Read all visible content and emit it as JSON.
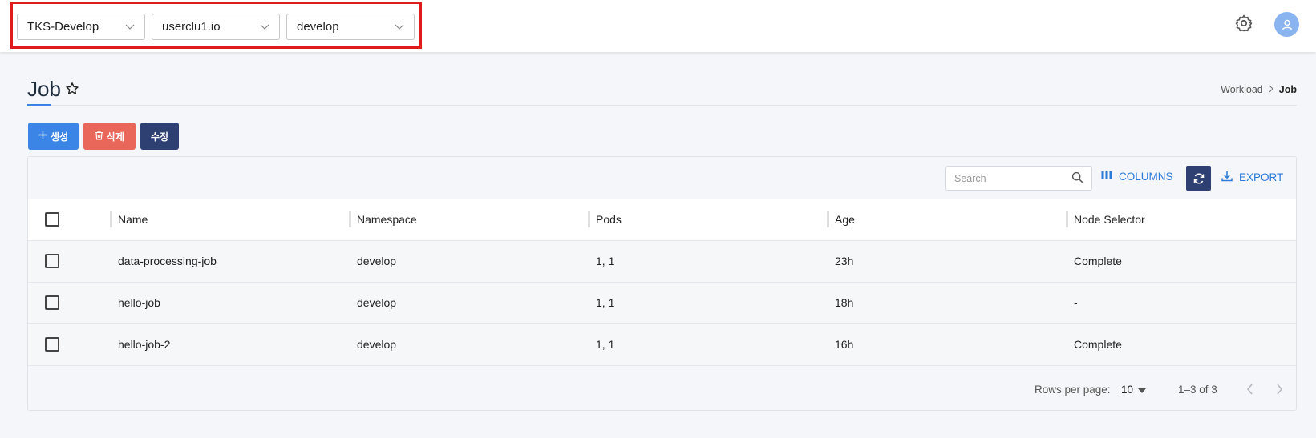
{
  "header": {
    "selectors": [
      {
        "value": "TKS-Develop"
      },
      {
        "value": "userclu1.io"
      },
      {
        "value": "develop"
      }
    ]
  },
  "page": {
    "title": "Job",
    "breadcrumb": [
      "Workload",
      "Job"
    ]
  },
  "actions": {
    "create_label": "생성",
    "delete_label": "삭제",
    "edit_label": "수정"
  },
  "toolbar": {
    "search_placeholder": "Search",
    "columns_label": "COLUMNS",
    "export_label": "EXPORT"
  },
  "table": {
    "columns": [
      "Name",
      "Namespace",
      "Pods",
      "Age",
      "Node Selector"
    ],
    "rows": [
      {
        "name": "data-processing-job",
        "namespace": "develop",
        "pods": "1, 1",
        "age": "23h",
        "node_selector": "Complete"
      },
      {
        "name": "hello-job",
        "namespace": "develop",
        "pods": "1, 1",
        "age": "18h",
        "node_selector": "-"
      },
      {
        "name": "hello-job-2",
        "namespace": "develop",
        "pods": "1, 1",
        "age": "16h",
        "node_selector": "Complete"
      }
    ]
  },
  "pagination": {
    "rows_per_page_label": "Rows per page:",
    "rows_per_page": "10",
    "range": "1–3 of 3"
  },
  "colors": {
    "accent": "#3b85e6",
    "danger": "#e8675a",
    "navy": "#2e3f72",
    "highlight_border": "#e01b1b"
  }
}
